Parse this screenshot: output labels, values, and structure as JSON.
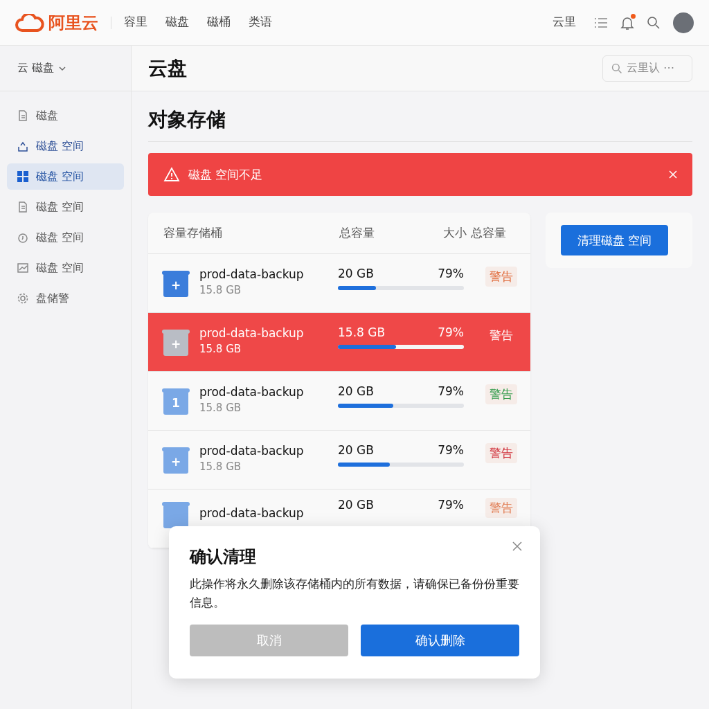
{
  "header": {
    "logo": "阿里云",
    "nav": [
      {
        "label": "容里",
        "selected": false
      },
      {
        "label": "磁盘",
        "selected": false
      },
      {
        "label": "磁桶",
        "selected": false
      },
      {
        "label": "类语"
      }
    ],
    "right_link": "云里",
    "has_notification": true
  },
  "sidebar": {
    "switcher": "云 磁盘",
    "items": [
      {
        "label": "磁盘",
        "selected": false
      },
      {
        "label": "磁盘 空间",
        "selected": false
      },
      {
        "label": "磁盘 空间",
        "selected": true
      },
      {
        "label": "磁盘 空间",
        "selected": false
      },
      {
        "label": "磁盘 空间",
        "selected": false
      },
      {
        "label": "磁盘 空间",
        "selected": false
      },
      {
        "label": "盘储警",
        "selected": false
      }
    ]
  },
  "page": {
    "title": "云盘",
    "search_placeholder": "云里认 ⋯",
    "section_title": "对象存储"
  },
  "alert": {
    "message": "磁盘 空间不足"
  },
  "table": {
    "columns": [
      "容量存储桶",
      "总容量",
      "大小",
      "总容量"
    ],
    "rows": [
      {
        "name": "prod-data-backup",
        "size": "15.8 GB",
        "total": "20 GB",
        "percent": "79%",
        "level": 0.3,
        "tag": "警告",
        "color": "#e06a3a",
        "icon_label": "+",
        "selected": false
      },
      {
        "name": "prod-data-backup",
        "size": "15.8 GB",
        "total": "15.8 GB",
        "percent": "79%",
        "level": 0.46,
        "tag": "警告",
        "color": "#ffffff",
        "icon_label": "+",
        "selected": true
      },
      {
        "name": "prod-data-backup",
        "size": "15.8 GB",
        "total": "20 GB",
        "percent": "79%",
        "level": 0.44,
        "tag": "警告",
        "color": "#2e9a48",
        "icon_label": "1",
        "selected": false
      },
      {
        "name": "prod-data-backup",
        "size": "15.8 GB",
        "total": "20 GB",
        "percent": "79%",
        "level": 0.41,
        "tag": "警告",
        "color": "#d0303a",
        "icon_label": "+",
        "selected": false
      },
      {
        "name": "prod-data-backup",
        "total": "20 GB",
        "percent": "79%",
        "tag": "警告",
        "color": "#e07a50",
        "selected": false
      }
    ]
  },
  "action_button": "清理磁盘 空间",
  "dialog": {
    "title": "确认清理",
    "message": "此操作将永久删除该存储桶内的所有数据，请确保已备份份重要信息。",
    "cancel": "取消",
    "confirm": "确认删除"
  }
}
